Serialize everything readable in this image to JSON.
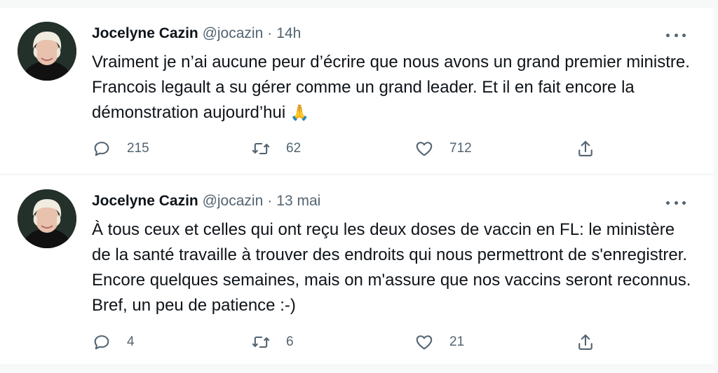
{
  "tweets": [
    {
      "name": "Jocelyne Cazin",
      "handle": "@jocazin",
      "separator": "·",
      "time": "14h",
      "text": "Vraiment je n’ai aucune peur d’écrire que nous avons un grand premier ministre. Francois legault a su gérer comme un grand leader. Et il en fait encore la démonstration aujourd’hui",
      "emoji": "🙏",
      "replies": "215",
      "retweets": "62",
      "likes": "712"
    },
    {
      "name": "Jocelyne Cazin",
      "handle": "@jocazin",
      "separator": "·",
      "time": "13 mai",
      "text": "À tous ceux et celles qui ont reçu les deux doses de vaccin en FL: le ministère de la santé travaille à trouver des endroits qui nous permettront de s'enregistrer. Encore quelques semaines, mais on m'assure que nos vaccins seront reconnus.  Bref, un peu de patience :-)",
      "replies": "4",
      "retweets": "6",
      "likes": "21"
    }
  ],
  "icons": {
    "more": "more-horizontal-icon",
    "reply": "reply-bubble-icon",
    "retweet": "retweet-arrows-icon",
    "like": "heart-icon",
    "share": "share-upload-icon"
  },
  "colors": {
    "text": "#0f1419",
    "secondary": "#536471",
    "divider": "#eff3f4",
    "background": "#f7f9f9"
  }
}
